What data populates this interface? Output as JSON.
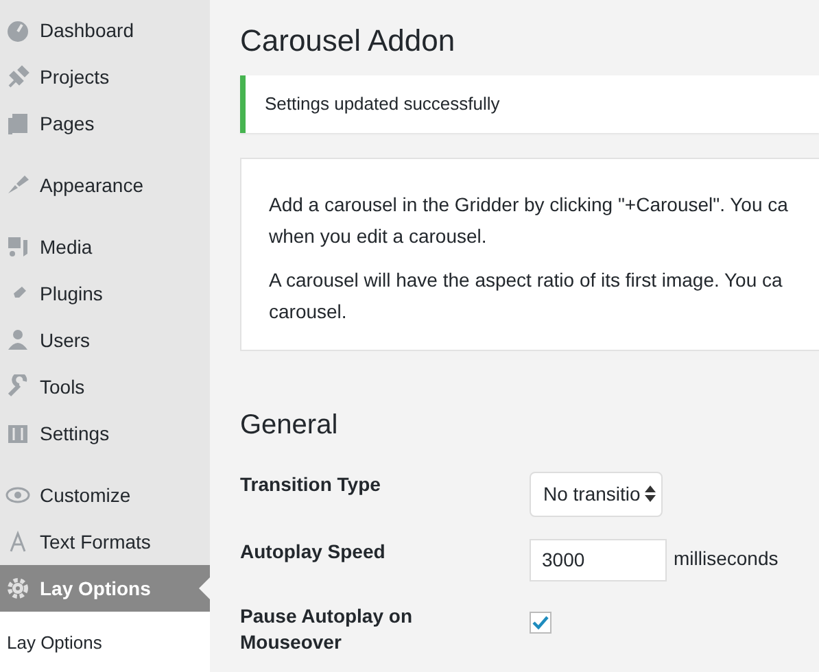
{
  "sidebar": {
    "items": [
      {
        "label": "Dashboard",
        "selected": false,
        "separated": false
      },
      {
        "label": "Projects",
        "selected": false,
        "separated": false
      },
      {
        "label": "Pages",
        "selected": false,
        "separated": false
      },
      {
        "label": "Appearance",
        "selected": false,
        "separated": true
      },
      {
        "label": "Media",
        "selected": false,
        "separated": true
      },
      {
        "label": "Plugins",
        "selected": false,
        "separated": false
      },
      {
        "label": "Users",
        "selected": false,
        "separated": false
      },
      {
        "label": "Tools",
        "selected": false,
        "separated": false
      },
      {
        "label": "Settings",
        "selected": false,
        "separated": false
      },
      {
        "label": "Customize",
        "selected": false,
        "separated": true
      },
      {
        "label": "Text Formats",
        "selected": false,
        "separated": false
      },
      {
        "label": "Lay Options",
        "selected": true,
        "separated": false
      }
    ],
    "submenu": [
      {
        "label": "Lay Options"
      }
    ]
  },
  "page": {
    "title": "Carousel Addon",
    "notice": "Settings updated successfully",
    "info_lines": [
      "Add a carousel in the Gridder by clicking \"+Carousel\". You ca",
      "when you edit a carousel."
    ],
    "info_lines_2": [
      "A carousel will have the aspect ratio of its first image. You ca",
      "carousel."
    ],
    "section_title": "General",
    "fields": [
      {
        "kind": "select",
        "label": "Transition Type",
        "value": "No transitio"
      },
      {
        "kind": "number",
        "label": "Autoplay Speed",
        "value": "3000",
        "suffix": "milliseconds"
      },
      {
        "kind": "checkbox",
        "label": "Pause Autoplay on Mouseover",
        "checked": true
      }
    ]
  }
}
